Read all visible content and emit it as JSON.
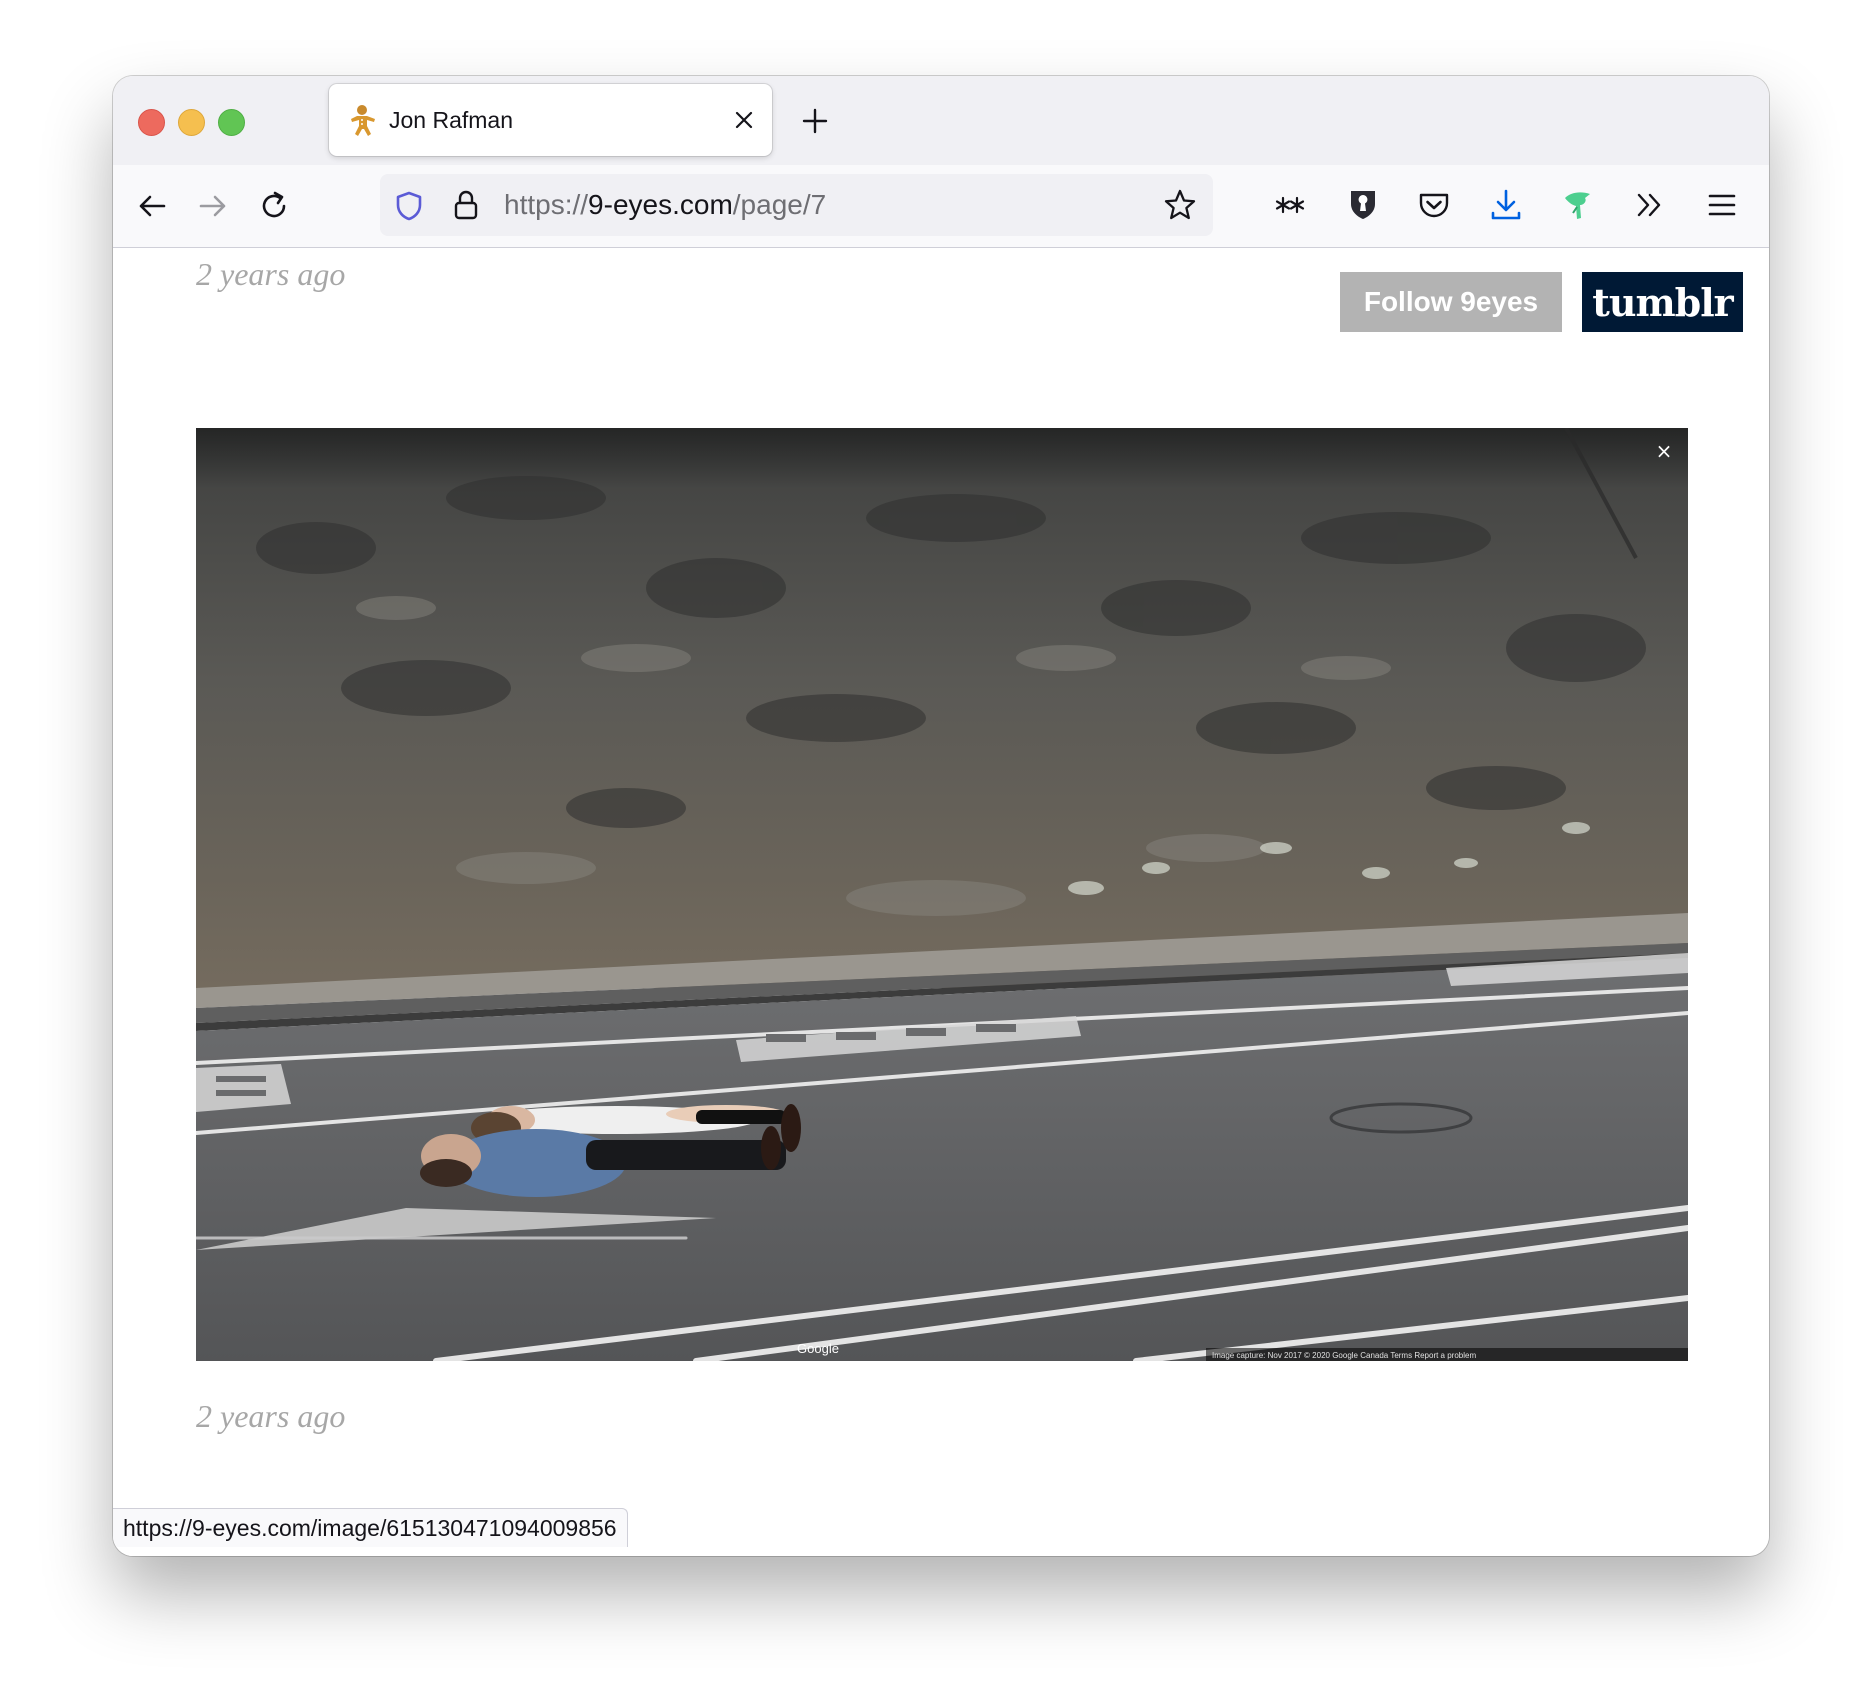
{
  "tab": {
    "title": "Jon Rafman",
    "favicon": "gingerbread-man-icon"
  },
  "address_bar": {
    "scheme": "https://",
    "host": "9-eyes.com",
    "path": "/page/7"
  },
  "page": {
    "timestamp_top": "2 years ago",
    "timestamp_bottom": "2 years ago",
    "follow_label": "Follow 9eyes",
    "tumblr_label": "tumblr",
    "photo": {
      "watermark": "Google",
      "credits": "Image capture: Nov 2017   © 2020 Google   Canada   Terms   Report a problem",
      "close_glyph": "×"
    }
  },
  "status_bar": {
    "link": "https://9-eyes.com/image/615130471094009856"
  },
  "colors": {
    "tumblr_navy": "#001935",
    "follow_gray": "#b3b3b3",
    "download_blue": "#0061e0"
  }
}
